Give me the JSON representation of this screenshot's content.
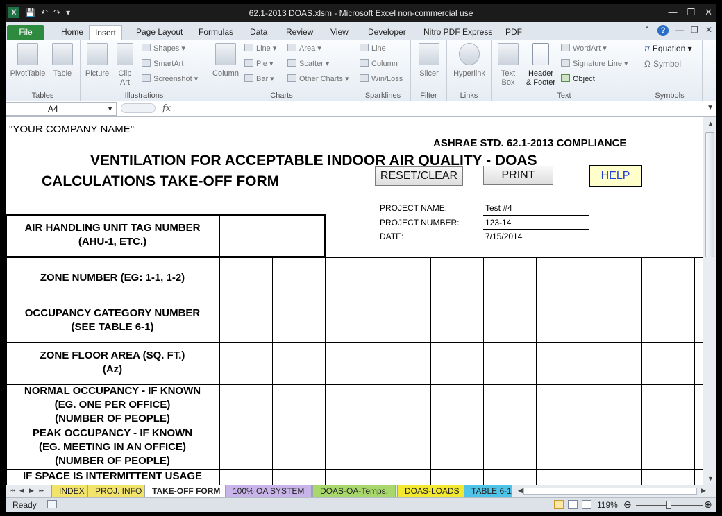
{
  "window": {
    "title": "62.1-2013 DOAS.xlsm  -  Microsoft Excel non-commercial use"
  },
  "ribbon_tabs": [
    "File",
    "Home",
    "Insert",
    "Page Layout",
    "Formulas",
    "Data",
    "Review",
    "View",
    "Developer",
    "Nitro PDF Express",
    "PDF"
  ],
  "active_tab": "Insert",
  "ribbon": {
    "tables": {
      "label": "Tables",
      "pivottable": "PivotTable",
      "table": "Table"
    },
    "illustrations": {
      "label": "Illustrations",
      "picture": "Picture",
      "clip_art_1": "Clip",
      "clip_art_2": "Art",
      "shapes": "Shapes",
      "smartart": "SmartArt",
      "screenshot": "Screenshot"
    },
    "charts": {
      "label": "Charts",
      "column": "Column",
      "line": "Line",
      "pie": "Pie",
      "bar": "Bar",
      "area": "Area",
      "scatter": "Scatter",
      "other": "Other Charts"
    },
    "sparklines": {
      "label": "Sparklines",
      "line": "Line",
      "column": "Column",
      "winloss": "Win/Loss"
    },
    "filter": {
      "label": "Filter",
      "slicer": "Slicer"
    },
    "links": {
      "label": "Links",
      "hyperlink": "Hyperlink"
    },
    "text": {
      "label": "Text",
      "textbox_1": "Text",
      "textbox_2": "Box",
      "header_1": "Header",
      "header_2": "& Footer",
      "wordart": "WordArt",
      "signature": "Signature Line",
      "object": "Object"
    },
    "symbols": {
      "label": "Symbols",
      "equation": "Equation",
      "symbol": "Symbol"
    }
  },
  "formula_bar": {
    "name_box": "A4",
    "fx": "fx",
    "formula": ""
  },
  "sheet": {
    "company": "\"YOUR COMPANY NAME\"",
    "ashrae": "ASHRAE STD. 62.1-2013 COMPLIANCE",
    "heading1": "VENTILATION FOR ACCEPTABLE INDOOR AIR QUALITY - DOAS",
    "heading2": "CALCULATIONS TAKE-OFF FORM",
    "reset_button": "RESET/CLEAR",
    "print_button": "PRINT",
    "help_button": "HELP",
    "project_name_label": "PROJECT NAME:",
    "project_name": "Test #4",
    "project_number_label": "PROJECT NUMBER:",
    "project_number": "123-14",
    "date_label": "DATE:",
    "date": "7/15/2014",
    "ahu_label_1": "AIR HANDLING UNIT TAG NUMBER",
    "ahu_label_2": "(AHU-1, ETC.)",
    "rows": [
      {
        "l1": "ZONE NUMBER  (EG: 1-1, 1-2)",
        "l2": "",
        "l3": ""
      },
      {
        "l1": "OCCUPANCY CATEGORY NUMBER",
        "l2": "(SEE TABLE 6-1)",
        "l3": ""
      },
      {
        "l1": "ZONE FLOOR AREA  (SQ. FT.)",
        "l2": "(Az)",
        "l3": ""
      },
      {
        "l1": "NORMAL OCCUPANCY - IF KNOWN",
        "l2": "(EG. ONE PER OFFICE)",
        "l3": "(NUMBER OF PEOPLE)"
      },
      {
        "l1": "PEAK OCCUPANCY - IF KNOWN",
        "l2": "(EG. MEETING IN AN OFFICE)",
        "l3": "(NUMBER OF PEOPLE)"
      },
      {
        "l1": "IF SPACE IS INTERMITTENT USAGE",
        "l2": "",
        "l3": ""
      }
    ]
  },
  "sheet_tabs": [
    {
      "label": "INDEX",
      "color": "#f2e36b"
    },
    {
      "label": "PROJ. INFO",
      "color": "#f2e36b"
    },
    {
      "label": "TAKE-OFF FORM",
      "color": "#ffffff"
    },
    {
      "label": "100% OA SYSTEM",
      "color": "#c8b4e8"
    },
    {
      "label": "DOAS-OA-Temps.",
      "color": "#a8d86b"
    },
    {
      "label": "DOAS-LOADS",
      "color": "#f2e830"
    },
    {
      "label": "TABLE 6-1",
      "color": "#4fc3e8"
    }
  ],
  "status": {
    "ready": "Ready",
    "zoom": "119%"
  }
}
